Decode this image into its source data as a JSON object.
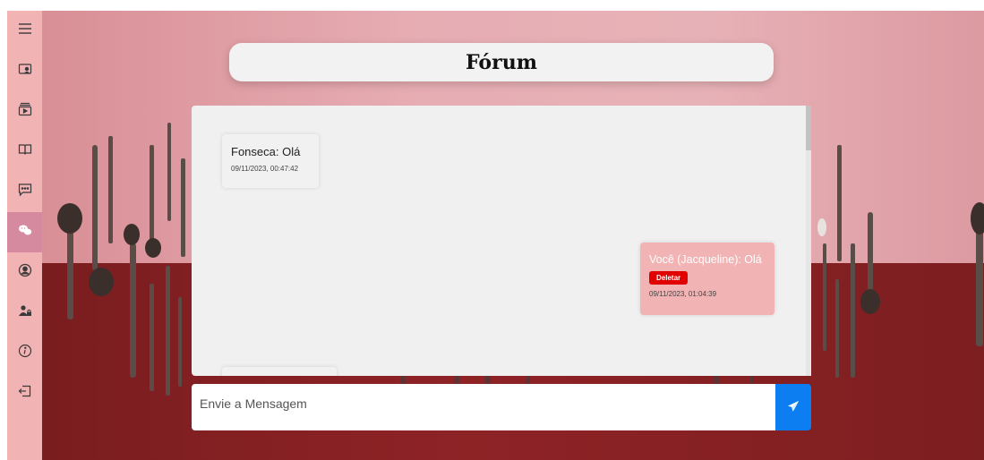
{
  "sidebar": {
    "items": [
      {
        "icon": "menu-icon",
        "active": false
      },
      {
        "icon": "profile-card-icon",
        "active": false
      },
      {
        "icon": "video-icon",
        "active": false
      },
      {
        "icon": "book-icon",
        "active": false
      },
      {
        "icon": "chat-bubble-icon",
        "active": false
      },
      {
        "icon": "forum-icon",
        "active": true
      },
      {
        "icon": "user-circle-icon",
        "active": false
      },
      {
        "icon": "users-lock-icon",
        "active": false
      },
      {
        "icon": "info-icon",
        "active": false
      },
      {
        "icon": "logout-icon",
        "active": false
      }
    ],
    "background": "#f1b3b3",
    "active_color": "#d58aa0"
  },
  "header": {
    "title": "Fórum"
  },
  "chat": {
    "messages": [
      {
        "author": "Fonseca",
        "text": "Fonseca: Olá",
        "timestamp": "09/11/2023, 00:47:42",
        "mine": false
      },
      {
        "author": "Você (Jacqueline)",
        "text": "Você (Jacqueline): Olá",
        "delete_label": "Deletar",
        "timestamp": "09/11/2023, 01:04:39",
        "mine": true
      }
    ]
  },
  "composer": {
    "placeholder": "Envie a Mensagem",
    "value": "",
    "send_icon": "paper-plane-icon"
  },
  "colors": {
    "accent": "#0d7ef2",
    "delete": "#e10000",
    "mine_bubble": "#f1b3b3"
  }
}
